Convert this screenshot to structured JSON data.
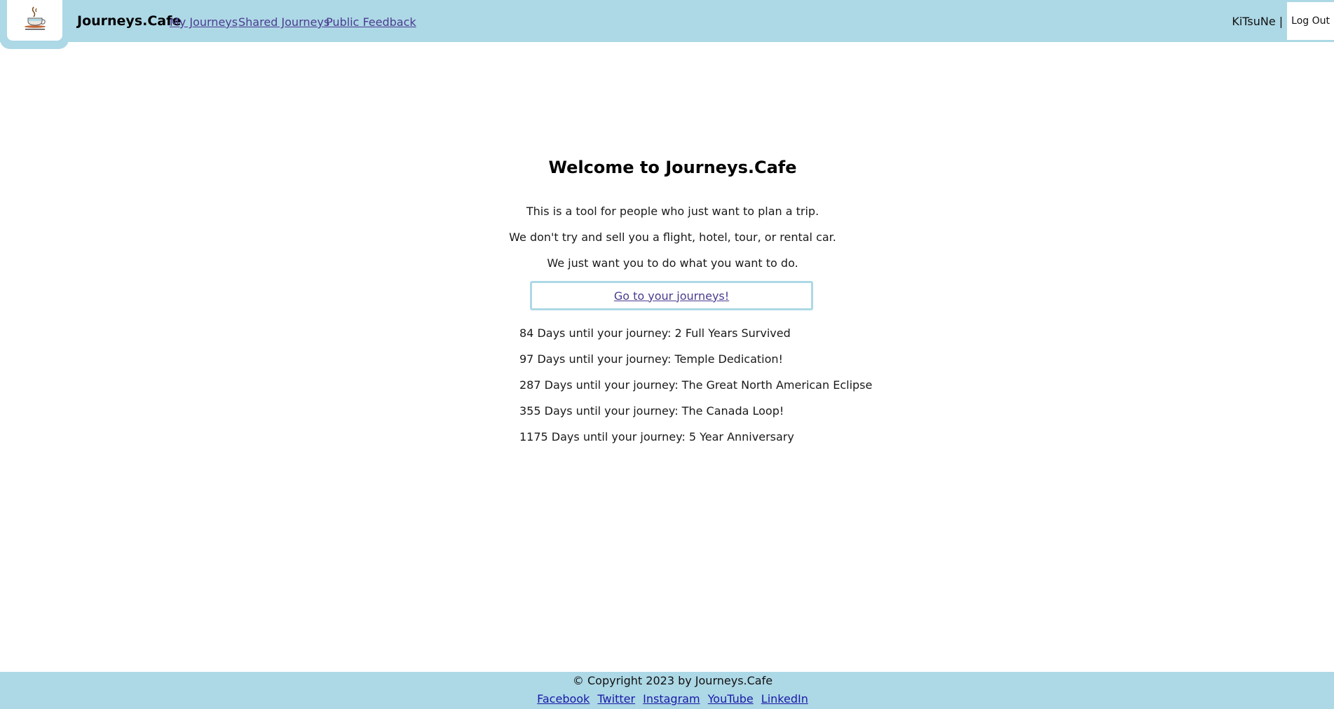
{
  "header": {
    "logo_icon": "coffee-cup-icon",
    "brand": "Journeys.Cafe",
    "nav": [
      {
        "label": "My Journeys"
      },
      {
        "label": "Shared Journeys"
      },
      {
        "label": "Public Feedback"
      }
    ],
    "username": "KiTsuNe |",
    "logout_label": "Log Out"
  },
  "main": {
    "title": "Welcome to Journeys.Cafe",
    "intro": [
      "This is a tool for people who just want to plan a trip.",
      "We don't try and sell you a flight, hotel, tour, or rental car.",
      "We just want you to do what you want to do."
    ],
    "cta_label": "Go to your journeys!",
    "countdowns": [
      "84 Days until your journey: 2 Full Years Survived",
      "97 Days until your journey: Temple Dedication!",
      "287 Days until your journey: The Great North American Eclipse",
      "355 Days until your journey: The Canada Loop!",
      "1175 Days until your journey: 5 Year Anniversary"
    ]
  },
  "footer": {
    "copyright": "© Copyright 2023 by Journeys.Cafe",
    "social": [
      {
        "label": "Facebook"
      },
      {
        "label": "Twitter"
      },
      {
        "label": "Instagram"
      },
      {
        "label": "YouTube"
      },
      {
        "label": "LinkedIn"
      }
    ]
  },
  "colors": {
    "header_bg": "#add8e6",
    "link_visited": "#4b3b8f",
    "link": "#1a1aa8"
  }
}
